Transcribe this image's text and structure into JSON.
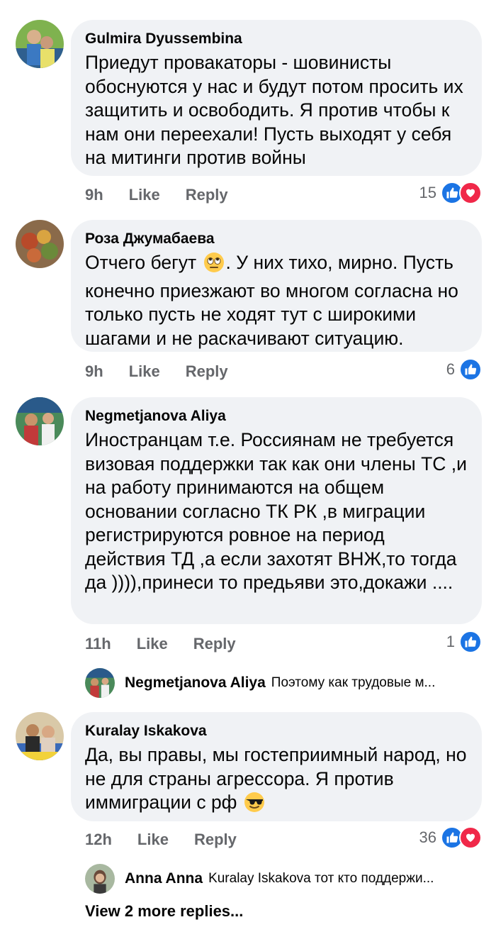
{
  "comments": [
    {
      "author": "Gulmira Dyussembina",
      "text": "Приедут провакаторы - шовинисты обоснуются у нас и будут потом просить их защитить и освободить. Я против чтобы к нам они переехали! Пусть выходят у себя на митинги против войны",
      "time": "9h",
      "like_label": "Like",
      "reply_label": "Reply",
      "reaction_count": "15",
      "reactions": [
        "like",
        "love"
      ]
    },
    {
      "author": "Роза Джумабаева",
      "text_before_emoji": "Отчего бегут",
      "emoji": "eye-roll-emoji",
      "text_after_emoji": ". У них тихо, мирно. Пусть конечно приезжают во многом согласна но только  пусть не ходят тут с широкими шагами и не раскачивают ситуацию.",
      "time": "9h",
      "like_label": "Like",
      "reply_label": "Reply",
      "reaction_count": "6",
      "reactions": [
        "like"
      ]
    },
    {
      "author": "Negmetjanova Aliya",
      "text": "Иностранцам т.е. Россиянам не требуется визовая поддержки так как они члены ТС ,и на работу принимаются на общем основании согласно ТК РК ,в миграции регистрируются ровное на период действия ТД ,а если захотят ВНЖ,то тогда да )))),принеси то предьяви это,докажи ....",
      "time": "11h",
      "like_label": "Like",
      "reply_label": "Reply",
      "reaction_count": "1",
      "reactions": [
        "like"
      ],
      "reply_preview": {
        "author": "Negmetjanova Aliya",
        "text": "Поэтому как трудовые м..."
      }
    },
    {
      "author": "Kuralay Iskakova",
      "text_before_emoji": "Да, вы правы, мы гостеприимный народ, но не для страны агрессора. Я против иммиграции с рф",
      "emoji": "sunglasses-emoji",
      "time": "12h",
      "like_label": "Like",
      "reply_label": "Reply",
      "reaction_count": "36",
      "reactions": [
        "like",
        "love"
      ],
      "reply_preview": {
        "author": "Anna Anna",
        "text": "Kuralay Iskakova  тот кто поддержи..."
      }
    }
  ],
  "view_more_label": "View 2 more replies...",
  "colors": {
    "bubble": "#f0f2f5",
    "meta_text": "#65676b",
    "like_blue": "#1b74e4",
    "love_red": "#f02849"
  }
}
